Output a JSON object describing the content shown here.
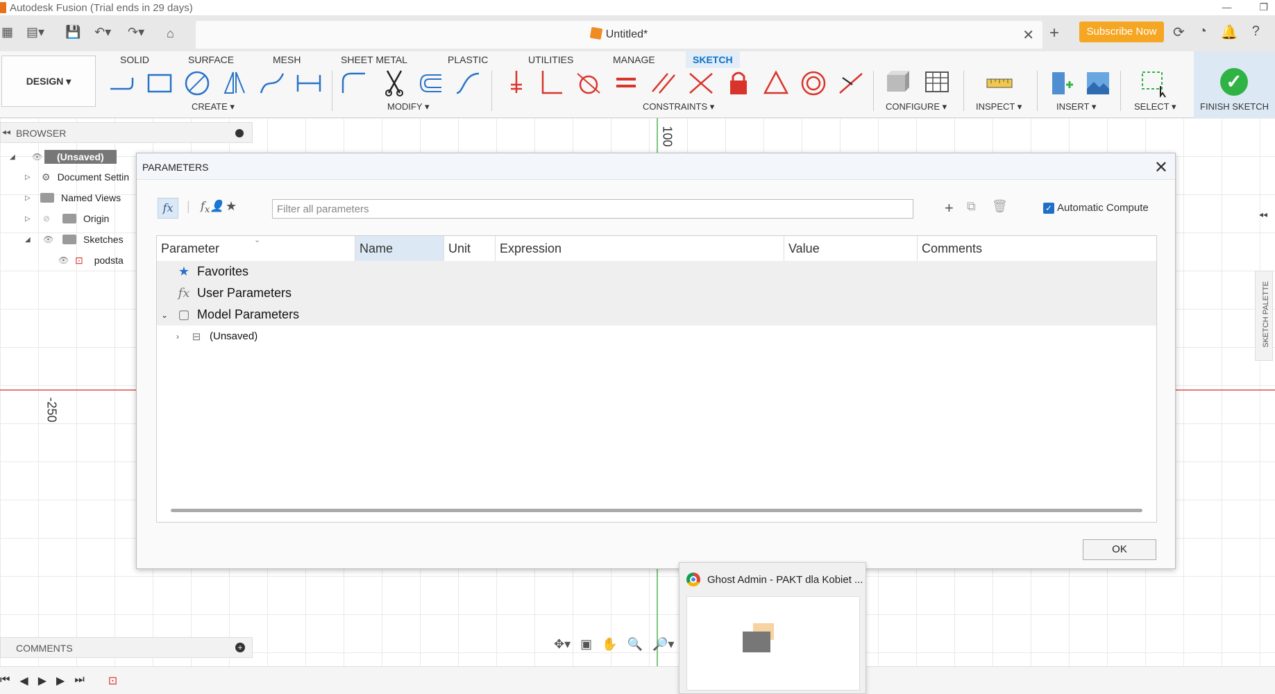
{
  "window": {
    "title": "Autodesk Fusion (Trial ends in 29 days)"
  },
  "tab": {
    "title": "Untitled*"
  },
  "subscribe_label": "Subscribe Now",
  "design_label": "DESIGN",
  "workspace_tabs": [
    "SOLID",
    "SURFACE",
    "MESH",
    "SHEET METAL",
    "PLASTIC",
    "UTILITIES",
    "MANAGE",
    "SKETCH"
  ],
  "groups": {
    "create": "CREATE",
    "modify": "MODIFY",
    "constraints": "CONSTRAINTS",
    "configure": "CONFIGURE",
    "inspect": "INSPECT",
    "insert": "INSERT",
    "select": "SELECT"
  },
  "finish_sketch": "FINISH SKETCH",
  "browser": {
    "title": "BROWSER",
    "items": [
      "(Unsaved)",
      "Document Settin",
      "Named Views",
      "Origin",
      "Sketches",
      "podsta"
    ]
  },
  "canvas": {
    "label_top": "100",
    "label_left": "-250"
  },
  "comments": {
    "title": "COMMENTS"
  },
  "palette": {
    "label": "SKETCH PALETTE"
  },
  "dialog": {
    "title": "PARAMETERS",
    "filter_placeholder": "Filter all parameters",
    "auto_compute": "Automatic Compute",
    "columns": [
      "Parameter",
      "Name",
      "Unit",
      "Expression",
      "Value",
      "Comments"
    ],
    "rows": [
      "Favorites",
      "User Parameters",
      "Model Parameters",
      "(Unsaved)"
    ],
    "ok": "OK"
  },
  "popup": {
    "title": "Ghost Admin - PAKT dla Kobiet ..."
  },
  "colors": {
    "accent": "#0e71c7",
    "subscribe": "#f5a623",
    "finish": "#2fb344"
  }
}
